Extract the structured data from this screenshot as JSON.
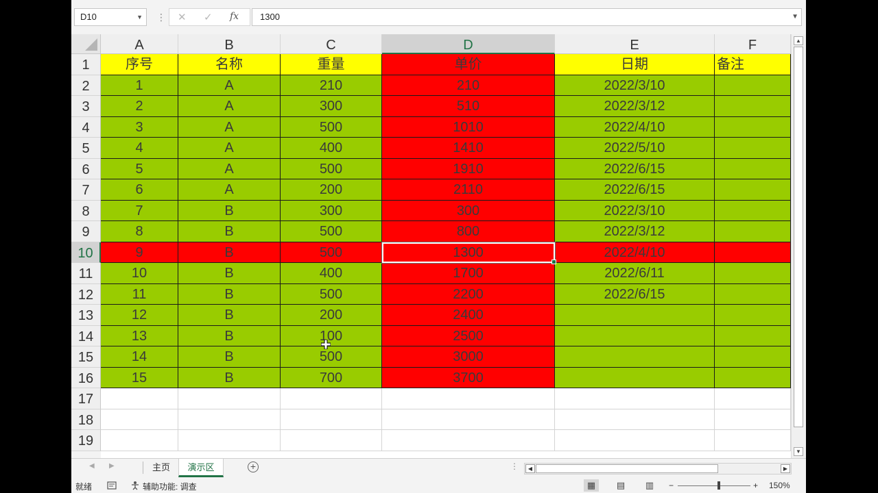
{
  "formula_bar": {
    "name_box": "D10",
    "cancel_icon": "✕",
    "enter_icon": "✓",
    "fx_label": "fx",
    "formula": "1300"
  },
  "columns": [
    "A",
    "B",
    "C",
    "D",
    "E",
    "F"
  ],
  "selected_column": "D",
  "rows": [
    "1",
    "2",
    "3",
    "4",
    "5",
    "6",
    "7",
    "8",
    "9",
    "10",
    "11",
    "12",
    "13",
    "14",
    "15",
    "16",
    "17",
    "18",
    "19"
  ],
  "selected_row": "10",
  "table": {
    "headers": [
      "序号",
      "名称",
      "重量",
      "单价",
      "日期",
      "备注"
    ],
    "rows": [
      [
        "1",
        "A",
        "210",
        "210",
        "2022/3/10",
        ""
      ],
      [
        "2",
        "A",
        "300",
        "510",
        "2022/3/12",
        ""
      ],
      [
        "3",
        "A",
        "500",
        "1010",
        "2022/4/10",
        ""
      ],
      [
        "4",
        "A",
        "400",
        "1410",
        "2022/5/10",
        ""
      ],
      [
        "5",
        "A",
        "500",
        "1910",
        "2022/6/15",
        ""
      ],
      [
        "6",
        "A",
        "200",
        "2110",
        "2022/6/15",
        ""
      ],
      [
        "7",
        "B",
        "300",
        "300",
        "2022/3/10",
        ""
      ],
      [
        "8",
        "B",
        "500",
        "800",
        "2022/3/12",
        ""
      ],
      [
        "9",
        "B",
        "500",
        "1300",
        "2022/4/10",
        ""
      ],
      [
        "10",
        "B",
        "400",
        "1700",
        "2022/6/11",
        ""
      ],
      [
        "11",
        "B",
        "500",
        "2200",
        "2022/6/15",
        ""
      ],
      [
        "12",
        "B",
        "200",
        "2400",
        "",
        ""
      ],
      [
        "13",
        "B",
        "100",
        "2500",
        "",
        ""
      ],
      [
        "14",
        "B",
        "500",
        "3000",
        "",
        ""
      ],
      [
        "15",
        "B",
        "700",
        "3700",
        "",
        ""
      ]
    ]
  },
  "colors": {
    "header_fill": "#ffff00",
    "data_fill": "#99cc00",
    "highlight_fill": "#ff0000",
    "accent": "#217346"
  },
  "sheet_tabs": [
    "主页",
    "演示区"
  ],
  "active_sheet": "演示区",
  "status": {
    "ready": "就绪",
    "accessibility": "辅助功能: 调查",
    "zoom_minus": "−",
    "zoom_plus": "+",
    "zoom": "150%"
  },
  "icons": [
    "cancel-icon",
    "enter-icon",
    "fx-icon",
    "dropdown-icon",
    "add-sheet-icon",
    "normal-view-icon",
    "page-layout-icon",
    "page-break-icon",
    "macro-record-icon",
    "accessibility-icon",
    "move-cursor-icon"
  ]
}
